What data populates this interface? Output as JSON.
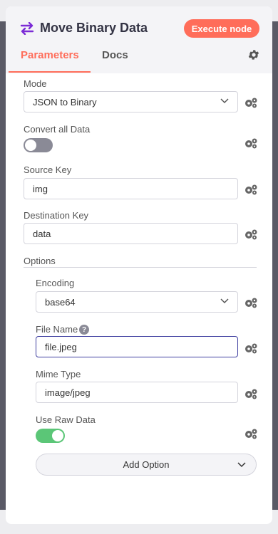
{
  "header": {
    "title": "Move Binary Data",
    "execute_label": "Execute node"
  },
  "tabs": [
    {
      "label": "Parameters",
      "active": true
    },
    {
      "label": "Docs",
      "active": false
    }
  ],
  "fields": {
    "mode": {
      "label": "Mode",
      "value": "JSON to Binary"
    },
    "convert_all": {
      "label": "Convert all Data",
      "on": false
    },
    "source_key": {
      "label": "Source Key",
      "value": "img"
    },
    "destination_key": {
      "label": "Destination Key",
      "value": "data"
    }
  },
  "options": {
    "label": "Options",
    "encoding": {
      "label": "Encoding",
      "value": "base64"
    },
    "file_name": {
      "label": "File Name",
      "value": "file.jpeg",
      "help": "?"
    },
    "mime_type": {
      "label": "Mime Type",
      "value": "image/jpeg"
    },
    "use_raw_data": {
      "label": "Use Raw Data",
      "on": true
    },
    "add_option_label": "Add Option"
  },
  "colors": {
    "accent": "#ff6d5a",
    "toggle_on": "#5bc677",
    "toggle_off": "#8a8a96",
    "title_icon": "#7b2bd6"
  }
}
